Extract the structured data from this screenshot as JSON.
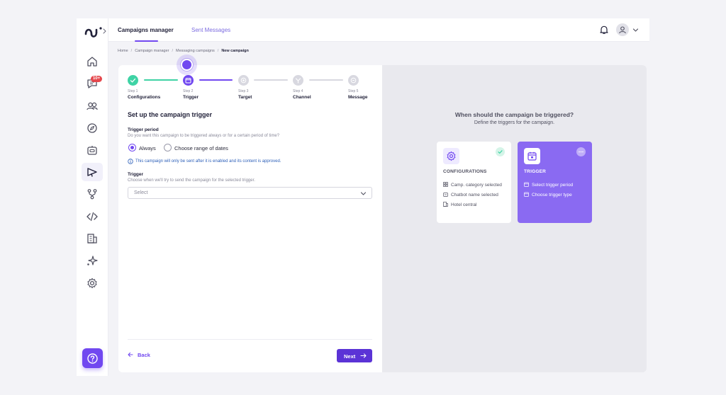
{
  "nav": {
    "tabs": [
      {
        "label": "Campaigns manager",
        "active": true
      },
      {
        "label": "Sent Messages",
        "active": false
      }
    ]
  },
  "sidebar": {
    "items": [
      {
        "icon": "home-icon"
      },
      {
        "icon": "chat-icon",
        "badge": "10+"
      },
      {
        "icon": "users-icon"
      },
      {
        "icon": "compass-icon"
      },
      {
        "icon": "bot-icon"
      },
      {
        "icon": "megaphone-icon",
        "active": true
      },
      {
        "icon": "flow-icon"
      },
      {
        "icon": "code-icon"
      },
      {
        "icon": "building-icon"
      },
      {
        "icon": "sparkle-icon"
      },
      {
        "icon": "gear-icon"
      }
    ],
    "help_icon": "help-icon"
  },
  "breadcrumb": [
    "Home",
    "Campaign manager",
    "Messaging campaigns",
    "New campaign"
  ],
  "steps": [
    {
      "num": "Step 1",
      "name": "Configurations",
      "status": "done"
    },
    {
      "num": "Step 2",
      "name": "Trigger",
      "status": "current"
    },
    {
      "num": "Step 3",
      "name": "Target",
      "status": "pending"
    },
    {
      "num": "Step 4",
      "name": "Channel",
      "status": "pending"
    },
    {
      "num": "Step 5",
      "name": "Message",
      "status": "pending"
    }
  ],
  "form": {
    "title": "Set up the campaign trigger",
    "period_label": "Trigger period",
    "period_help": "Do you want this campaign to be triggered always or for a certain period of time?",
    "options": [
      "Always",
      "Choose range of dates"
    ],
    "selected_option": "Always",
    "info": "This campaign will only be sent after it is enabled and its content is approved.",
    "trigger_label": "Trigger",
    "trigger_help": "Choose when we'll try to send the campaign for the selected trigger.",
    "trigger_placeholder": "Select",
    "back_label": "Back",
    "next_label": "Next"
  },
  "preview": {
    "title": "When should the campaign be triggered?",
    "subtitle": "Define the triggers for the campaign.",
    "cards": [
      {
        "title": "CONFIGURATIONS",
        "status": "complete",
        "items": [
          "Camp. category selected",
          "Chatbot name selected",
          "Hotel central"
        ]
      },
      {
        "title": "TRIGGER",
        "status": "in-progress",
        "items": [
          "Select trigger period",
          "Choose trigger type"
        ]
      }
    ]
  },
  "colors": {
    "accent": "#7148f0",
    "button": "#5b33d6",
    "success": "#3fd3a5",
    "info": "#2c5fb8",
    "badge": "#e5484d"
  }
}
